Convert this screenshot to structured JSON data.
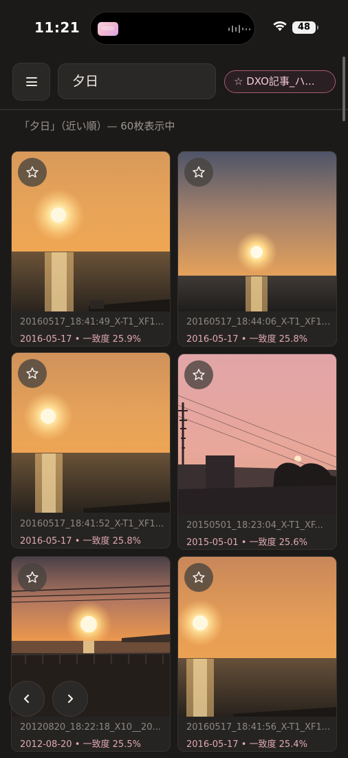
{
  "status_bar": {
    "time": "11:21",
    "battery": "48"
  },
  "header": {
    "search_value": "夕日",
    "tag_chip": "☆ DXO記事_ハ..."
  },
  "result_summary": "「夕日」（近い順）— 60枚表示中",
  "photos": [
    {
      "filename": "20160517_18:41:49_X-T1_XF1...",
      "date": "2016-05-17",
      "score": "一致度 25.9%"
    },
    {
      "filename": "20160517_18:44:06_X-T1_XF1...",
      "date": "2016-05-17",
      "score": "一致度 25.8%"
    },
    {
      "filename": "20160517_18:41:52_X-T1_XF1...",
      "date": "2016-05-17",
      "score": "一致度 25.8%"
    },
    {
      "filename": "20150501_18:23:04_X-T1_XF...",
      "date": "2015-05-01",
      "score": "一致度 25.6%"
    },
    {
      "filename": "20120820_18:22:18_X10__20...",
      "date": "2012-08-20",
      "score": "一致度 25.5%"
    },
    {
      "filename": "20160517_18:41:56_X-T1_XF1...",
      "date": "2016-05-17",
      "score": "一致度 25.4%"
    }
  ],
  "separator": "•",
  "icons": {
    "menu": "hamburger-icon",
    "star": "star-outline-icon",
    "prev": "chevron-left-icon",
    "next": "chevron-right-icon",
    "wifi": "wifi-icon"
  },
  "colors": {
    "background": "#1b1a19",
    "accent": "#e0a9b6",
    "chip_border": "#a85a72"
  }
}
